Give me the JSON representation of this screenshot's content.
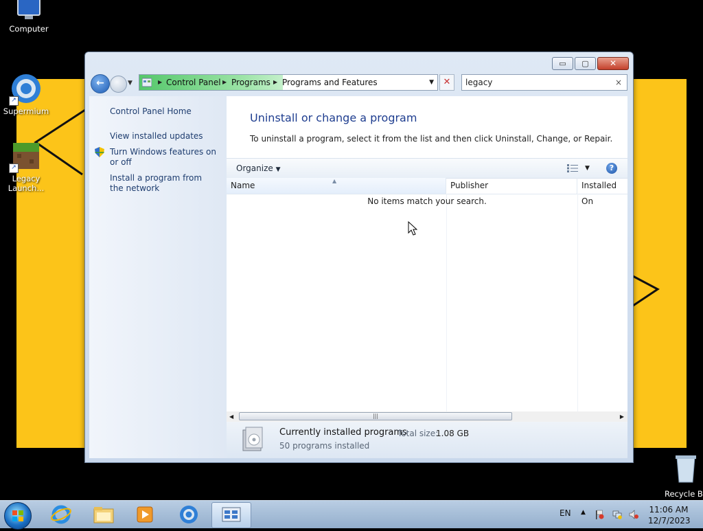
{
  "desktop": {
    "icons": [
      {
        "label": "Computer"
      },
      {
        "label": "Supermium"
      },
      {
        "label": "Legacy Launch..."
      },
      {
        "label": "Recycle Bi"
      }
    ]
  },
  "window": {
    "controls": {
      "minimize": "▭",
      "maximize": "▢",
      "close": "✕"
    },
    "address": {
      "crumbs": [
        "Control Panel",
        "Programs",
        "Programs and Features"
      ]
    },
    "search": {
      "value": "legacy",
      "clear": "×"
    },
    "left_pane": {
      "home": "Control Panel Home",
      "links": [
        "View installed updates",
        "Turn Windows features on or off",
        "Install a program from the network"
      ]
    },
    "content": {
      "heading": "Uninstall or change a program",
      "instructions": "To uninstall a program, select it from the list and then click Uninstall, Change, or Repair.",
      "toolbar": {
        "organize": "Organize"
      },
      "columns": [
        "Name",
        "Publisher",
        "Installed On"
      ],
      "empty_message": "No items match your search.",
      "details": {
        "title": "Currently installed programs",
        "total_size_label": "Total size:",
        "total_size": "1.08 GB",
        "count": "50 programs installed"
      }
    }
  },
  "taskbar": {
    "language": "EN",
    "time": "11:06 AM",
    "date": "12/7/2023"
  },
  "colors": {
    "wallpaper": "#fcc419",
    "accent": "#1e3d8f"
  }
}
